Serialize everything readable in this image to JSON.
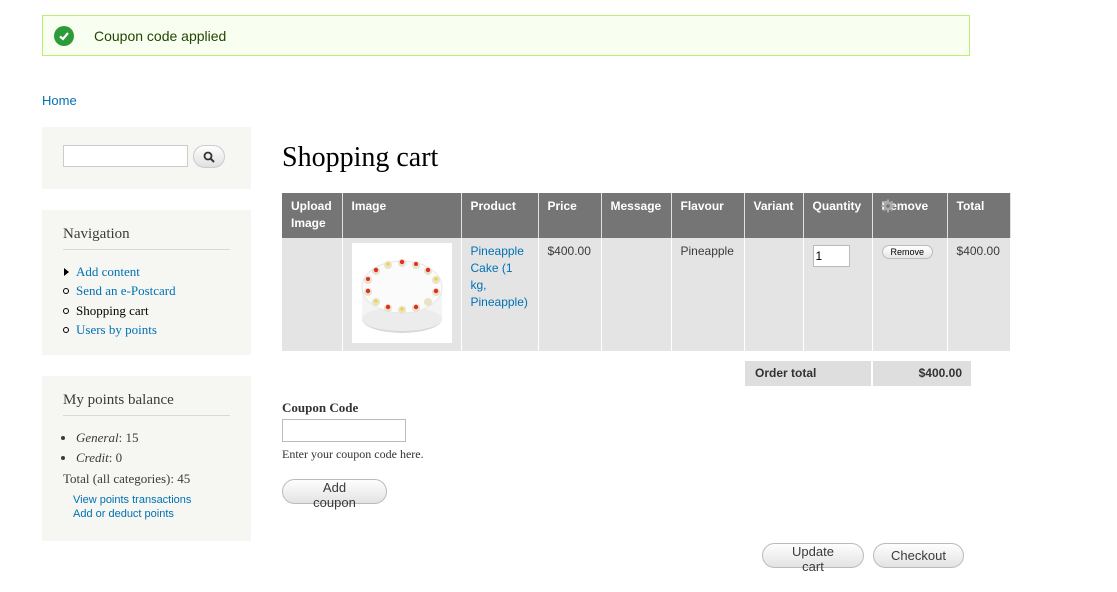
{
  "message": {
    "text": "Coupon code applied",
    "color": "#2c9b3a"
  },
  "breadcrumb": {
    "home": "Home"
  },
  "search": {
    "value": "",
    "icon": "search-icon"
  },
  "navigation": {
    "title": "Navigation",
    "items": [
      {
        "label": "Add content",
        "bullet": "triangle",
        "link": true
      },
      {
        "label": "Send an e-Postcard",
        "bullet": "circle",
        "link": true
      },
      {
        "label": "Shopping cart",
        "bullet": "circle",
        "link": false
      },
      {
        "label": "Users by points",
        "bullet": "circle",
        "link": true
      }
    ]
  },
  "points": {
    "title": "My points balance",
    "categories": [
      {
        "name": "General",
        "value": ": 15"
      },
      {
        "name": "Credit",
        "value": ": 0"
      }
    ],
    "total": "Total (all categories): 45",
    "links": [
      "View points transactions",
      "Add or deduct points"
    ]
  },
  "page_title": "Shopping cart",
  "cart": {
    "headers": [
      "Upload Image",
      "Image",
      "Product",
      "Price",
      "Message",
      "Flavour",
      "Variant",
      "Quantity",
      "Remove",
      "Total"
    ],
    "rows": [
      {
        "upload_image": "",
        "product": "Pineapple Cake (1 kg, Pineapple)",
        "price": "$400.00",
        "message": "",
        "flavour": "Pineapple",
        "variant": "",
        "quantity": "1",
        "remove_label": "Remove",
        "total": "$400.00"
      }
    ],
    "order_total_label": "Order total",
    "order_total_value": "$400.00"
  },
  "coupon": {
    "label": "Coupon Code",
    "value": "",
    "help": "Enter your coupon code here.",
    "button": "Add coupon"
  },
  "actions": {
    "update": "Update cart",
    "checkout": "Checkout"
  }
}
